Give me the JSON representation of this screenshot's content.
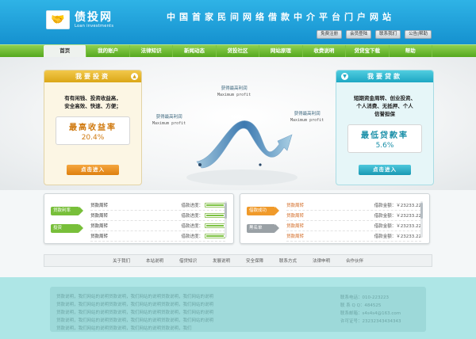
{
  "header": {
    "logo_icon": "handshake-icon",
    "logo_name": "债投网",
    "logo_en": "Loan investments",
    "slogan": "中国首家民间网络借款中介平台门户网站",
    "quick_links": [
      "免费注册",
      "会员登陆",
      "联系我们",
      "公告|帮助"
    ]
  },
  "nav": {
    "items": [
      "首页",
      "我的账户",
      "法律知识",
      "新闻动态",
      "贷投社区",
      "网站原理",
      "收费说明",
      "贷贷宝下载",
      "帮助"
    ],
    "active_index": 0
  },
  "banner": {
    "left_panel": {
      "title": "我要投资",
      "icon": "chevron-up-icon",
      "desc": [
        "有有闲钱、投资收益高，",
        "安全高效、快速、方便；"
      ],
      "rate_title": "最高收益率",
      "rate_value": "20.4%",
      "button": "点击进入"
    },
    "right_panel": {
      "title": "我要贷款",
      "icon": "chevron-down-icon",
      "desc": [
        "短期资金周转、创业投资、",
        "个人消费、无抵押、个人",
        "信誉担保"
      ],
      "rate_title": "最低贷款率",
      "rate_value": "5.6%",
      "button": "点击进入"
    },
    "bubbles": [
      {
        "cn": "获得最高利润",
        "en": "Maximum profit"
      },
      {
        "cn": "获得最高利润",
        "en": "Maximum profit"
      },
      {
        "cn": "获得最高利润",
        "en": "Maximum profit"
      }
    ]
  },
  "info_left": {
    "tags": [
      "贷款利率",
      "投资"
    ],
    "rows": [
      {
        "name": "贷款周转",
        "meta": "借款进度：",
        "progress": 0.9
      },
      {
        "name": "贷款周转",
        "meta": "借款进度：",
        "progress": 0.9
      },
      {
        "name": "贷款周转",
        "meta": "借款进度：",
        "progress": 0.9
      },
      {
        "name": "贷款周转",
        "meta": "借款进度：",
        "progress": 0.9
      }
    ]
  },
  "info_right": {
    "tags": [
      "借款成功",
      "黑名单"
    ],
    "rows": [
      {
        "name": "贷款周转",
        "meta": "借款金额：￥23233.22"
      },
      {
        "name": "贷款周转",
        "meta": "借款金额：￥23233.22"
      },
      {
        "name": "贷款周转",
        "meta": "借款金额：￥23233.22"
      },
      {
        "name": "贷款周转",
        "meta": "借款金额：￥23233.22"
      }
    ]
  },
  "footer_links": [
    "关于我们",
    "本站说明",
    "借贷知识",
    "发展说明",
    "安全保障",
    "联系方式",
    "法律申明",
    "合作伙伴"
  ],
  "bottom": {
    "lines": [
      "贷款说明，我们网站的说明贷款说明，我们网站的说明贷款说明，我们网站的说明",
      "贷款说明，我们网站的说明贷款说明，我们网站的说明贷款说明，我们网站的说明",
      "贷款说明，我们网站的说明贷款说明，我们网站的说明贷款说明，我们网站的说明",
      "贷款说明，我们网站的说明贷款说明，我们网站的说明贷款说明，我们网站的说明",
      "贷款说明，我们网站的说明贷款说明，我们网站的说明贷款说明，我们"
    ],
    "contact": [
      "联系电话：010-223223",
      "联 系 Q Q：484525",
      "联系邮箱：s4s4s4@163.com",
      "许可证号：23232343434343"
    ]
  }
}
